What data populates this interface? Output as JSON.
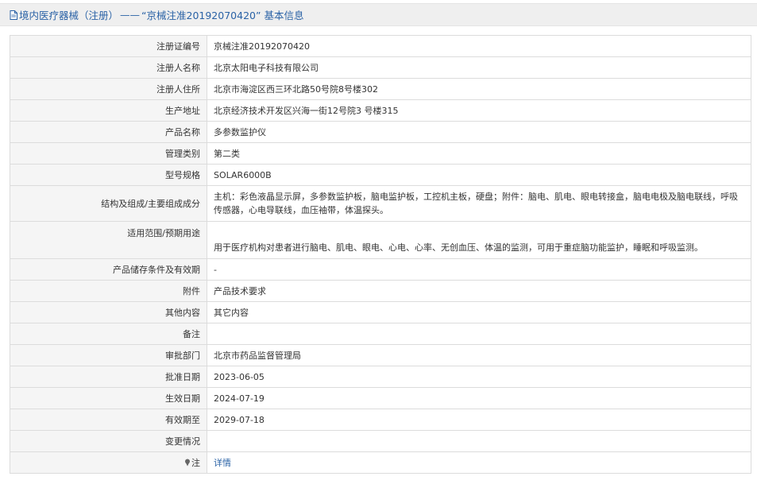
{
  "header": {
    "section": "境内医疗器械（注册）",
    "dash": "——",
    "reg_quoted": "“京械注准20192070420”",
    "suffix": "基本信息"
  },
  "rows": [
    {
      "label": "注册证编号",
      "value": "京械注准20192070420"
    },
    {
      "label": "注册人名称",
      "value": "北京太阳电子科技有限公司"
    },
    {
      "label": "注册人住所",
      "value": "北京市海淀区西三环北路50号院8号楼302"
    },
    {
      "label": "生产地址",
      "value": "北京经济技术开发区兴海一街12号院3 号楼315"
    },
    {
      "label": "产品名称",
      "value": "多参数监护仪"
    },
    {
      "label": "管理类别",
      "value": "第二类"
    },
    {
      "label": "型号规格",
      "value": "SOLAR6000B"
    },
    {
      "label": "结构及组成/主要组成成分",
      "value": "主机：彩色液晶显示屏，多参数监护板，脑电监护板，工控机主板，硬盘；附件：脑电、肌电、眼电转接盒，脑电电极及脑电联线，呼吸传感器，心电导联线，血压袖带，体温探头。"
    },
    {
      "label": "适用范围/预期用途",
      "value": "用于医疗机构对患者进行脑电、肌电、眼电、心电、心率、无创血压、体温的监测，可用于重症脑功能监护，睡眠和呼吸监测。"
    },
    {
      "label": "产品储存条件及有效期",
      "value": "-"
    },
    {
      "label": "附件",
      "value": "产品技术要求"
    },
    {
      "label": "其他内容",
      "value": "其它内容"
    },
    {
      "label": "备注",
      "value": ""
    },
    {
      "label": "审批部门",
      "value": "北京市药品监督管理局"
    },
    {
      "label": "批准日期",
      "value": "2023-06-05"
    },
    {
      "label": "生效日期",
      "value": "2024-07-19"
    },
    {
      "label": "有效期至",
      "value": "2029-07-18"
    },
    {
      "label": "变更情况",
      "value": ""
    },
    {
      "label": "注",
      "value": "详情"
    }
  ]
}
